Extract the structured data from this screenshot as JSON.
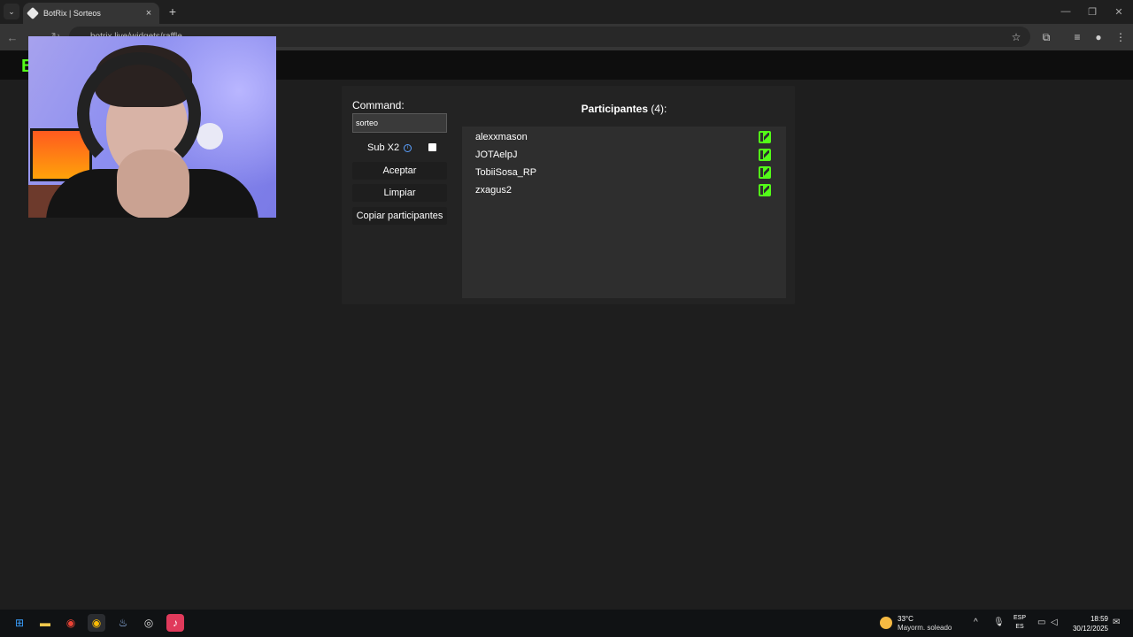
{
  "browser": {
    "tab_title": "BotRix | Sorteos",
    "tab_close": "×",
    "new_tab": "+",
    "tab_list": "⌄",
    "url": "botrix.live/widgets/raffle"
  },
  "site": {
    "logo": "B"
  },
  "giveaway": {
    "command_label": "Command:",
    "command_value": "sorteo",
    "sub_label": "Sub X2",
    "sub_checked": true,
    "accept_label": "Aceptar",
    "clear_label": "Limpiar",
    "copy_label": "Copiar participantes",
    "participants_title": "Participantes",
    "participants_count": "(4):",
    "participants": [
      {
        "name": "alexxmason",
        "platform": "kick"
      },
      {
        "name": "JOTAelpJ",
        "platform": "kick"
      },
      {
        "name": "TobiiSosa_RP",
        "platform": "kick"
      },
      {
        "name": "zxagus2",
        "platform": "kick"
      }
    ]
  },
  "taskbar": {
    "weather_temp": "33°C",
    "weather_desc": "Mayorm. soleado",
    "lang_1": "ESP",
    "lang_2": "ES",
    "time": "18:59",
    "date": "30/12/2025"
  },
  "colors": {
    "kick_green": "#53fc18",
    "panel_bg": "#232323",
    "page_bg": "#1e1e1e"
  }
}
